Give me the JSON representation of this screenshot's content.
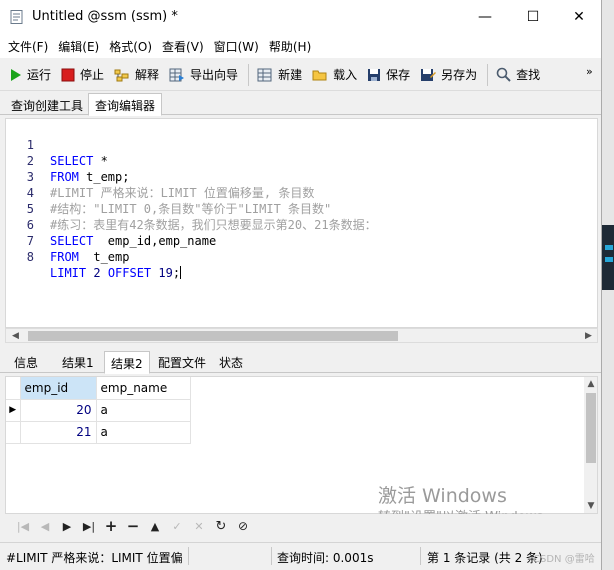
{
  "window": {
    "title": "Untitled @ssm (ssm) *",
    "minimize_glyph": "—",
    "maximize_glyph": "☐",
    "close_glyph": "✕"
  },
  "menu": [
    "文件(F)",
    "编辑(E)",
    "格式(O)",
    "查看(V)",
    "窗口(W)",
    "帮助(H)"
  ],
  "toolbar": {
    "run": "运行",
    "stop": "停止",
    "explain": "解释",
    "export_wizard": "导出向导",
    "new": "新建",
    "load": "载入",
    "save": "保存",
    "save_as": "另存为",
    "find": "查找",
    "more": "»"
  },
  "editor_tabs": [
    "查询创建工具",
    "查询编辑器"
  ],
  "editor": {
    "lines": [
      {
        "n": "1",
        "k1": "SELECT",
        "t1": " *"
      },
      {
        "n": "2",
        "k1": "FROM",
        "t1": " t_emp;"
      },
      {
        "n": "3",
        "c": "#LIMIT 严格来说：LIMIT 位置偏移量, 条目数"
      },
      {
        "n": "4",
        "c": "#结构：\"LIMIT 0,条目数\"等价于\"LIMIT 条目数\""
      },
      {
        "n": "5",
        "c": "#练习：表里有42条数据，我们只想要显示第20、21条数据："
      },
      {
        "n": "6",
        "k1": "SELECT",
        "t1": "  emp_id,emp_name"
      },
      {
        "n": "7",
        "k1": "FROM",
        "t1": "  t_emp"
      },
      {
        "n": "8",
        "k1": "LIMIT",
        "n1": " 2 ",
        "k2": "OFFSET",
        "n2": " 19",
        "t2": ";"
      }
    ]
  },
  "result_tabs": [
    "信息",
    "结果1",
    "结果2",
    "配置文件",
    "状态"
  ],
  "grid": {
    "columns": [
      "emp_id",
      "emp_name"
    ],
    "rows": [
      {
        "emp_id": "20",
        "emp_name": "a"
      },
      {
        "emp_id": "21",
        "emp_name": "a"
      }
    ]
  },
  "watermark": {
    "line1": "激活 Windows",
    "line2": "转到\"设置\"以激活 Windows。"
  },
  "status": {
    "query": "#LIMIT 严格来说：LIMIT 位置偏",
    "time": "查询时间: 0.001s",
    "records": "第 1 条记录 (共 2 条)",
    "credit": "CSDN @雷哈"
  }
}
